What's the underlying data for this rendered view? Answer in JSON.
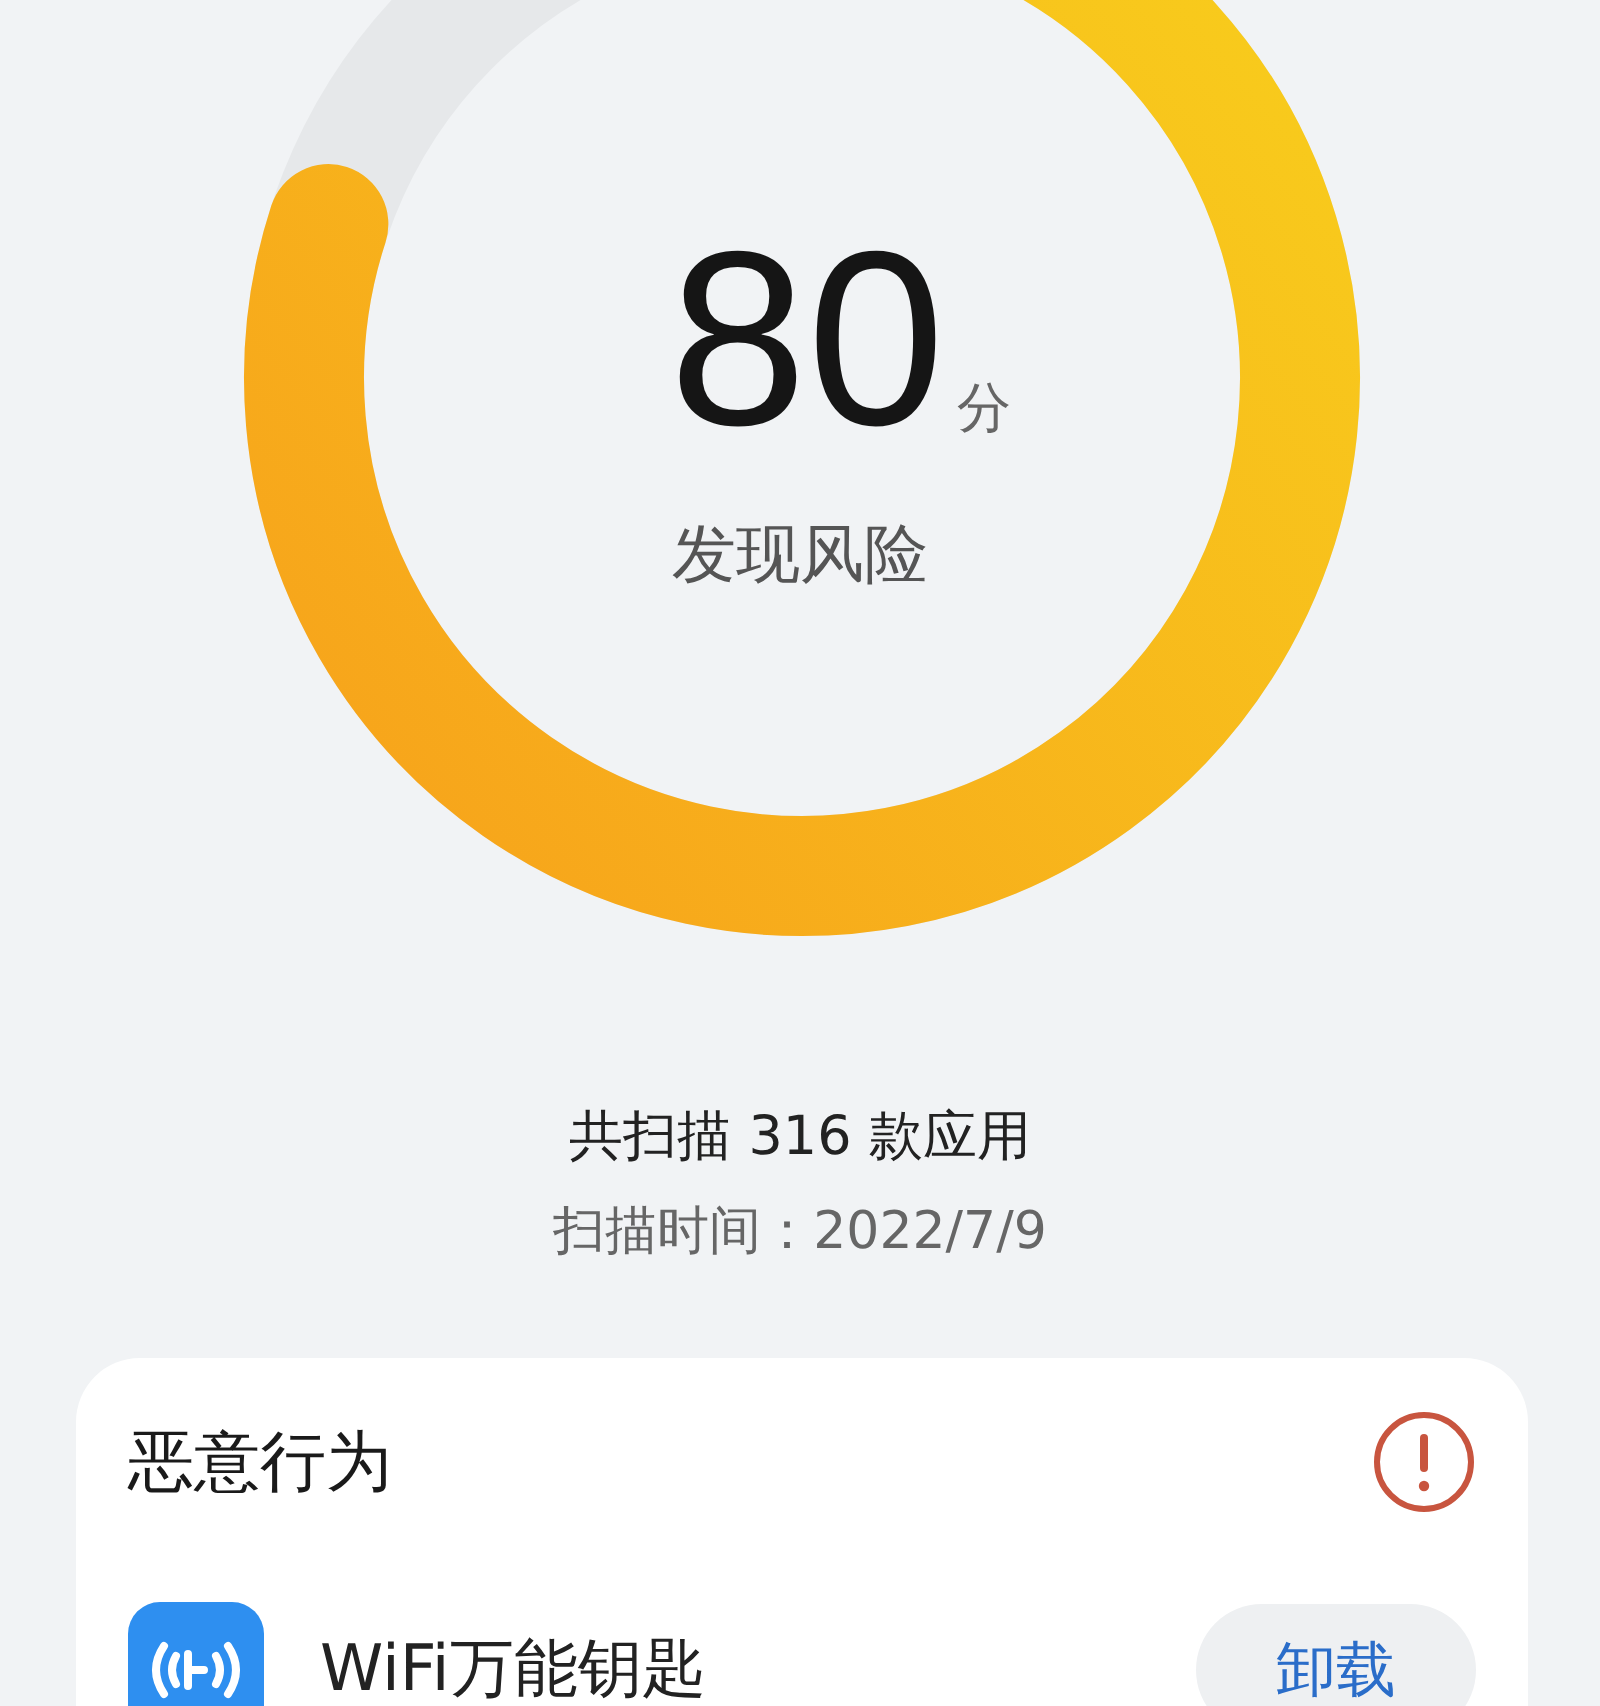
{
  "score_ring": {
    "score": "80",
    "unit": "分",
    "status": "发现风险"
  },
  "scan_summary": "共扫描 316 款应用",
  "scan_time": "扫描时间：2022/7/9",
  "risk_card": {
    "title": "恶意行为",
    "alert": true,
    "apps": [
      {
        "name": "WiFi万能钥匙",
        "action": "卸载"
      }
    ]
  }
}
